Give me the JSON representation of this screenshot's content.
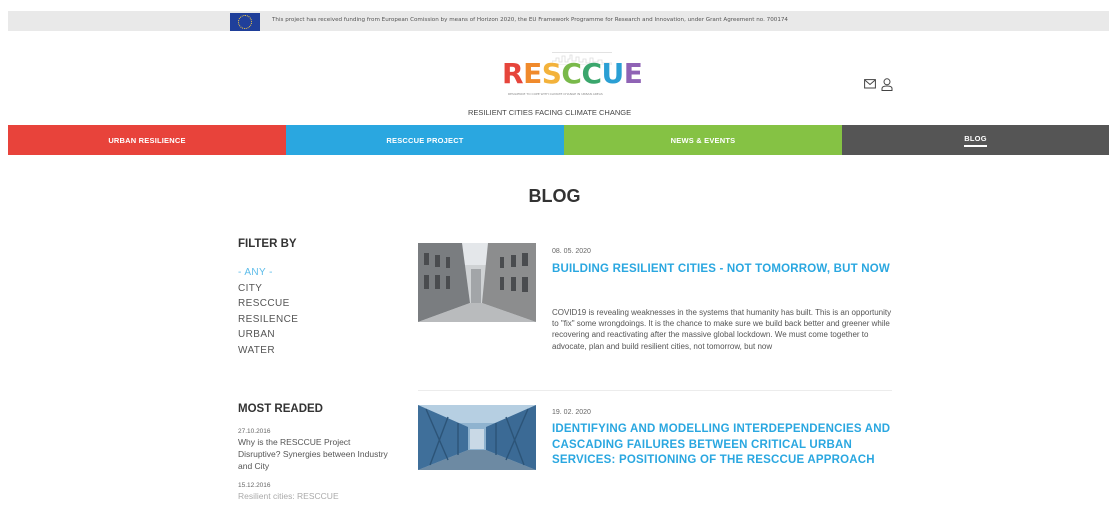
{
  "funding_notice": "This project has received funding from European Comission by means of Horizon 2020, the EU Framework Programme for Research and Innovation, under Grant Agreement no. 700174",
  "header": {
    "logo_letters": [
      "R",
      "E",
      "S",
      "C",
      "C",
      "U",
      "E"
    ],
    "logo_subtitle": "RESILIENCE TO COPE WITH CLIMATE CHANGE IN URBAN AREAS",
    "tagline": "RESILIENT CITIES FACING CLIMATE CHANGE",
    "icons": [
      "mail-icon",
      "user-icon"
    ]
  },
  "nav": {
    "items": [
      {
        "label": "URBAN RESILIENCE",
        "color": "#e8433b"
      },
      {
        "label": "RESCCUE PROJECT",
        "color": "#2aa7e0"
      },
      {
        "label": "NEWS & EVENTS",
        "color": "#85c244"
      },
      {
        "label": "BLOG",
        "color": "#555555",
        "active": true
      }
    ]
  },
  "page_title": "BLOG",
  "sidebar": {
    "filter_heading": "FILTER BY",
    "filters": [
      "- ANY -",
      "CITY",
      "RESCCUE",
      "RESILENCE",
      "URBAN",
      "WATER"
    ],
    "most_read_heading": "MOST READED",
    "most_read": [
      {
        "date": "27.10.2016",
        "title": "Why is the RESCCUE Project Disruptive? Synergies between Industry and City"
      },
      {
        "date": "15.12.2016",
        "title": "Resilient cities: RESCCUE"
      }
    ]
  },
  "posts": [
    {
      "date": "08. 05. 2020",
      "title": "BUILDING RESILIENT CITIES - NOT TOMORROW, BUT NOW",
      "excerpt": "COVID19 is revealing weaknesses in the systems that humanity has built. This is an opportunity to \"fix\" some wrongdoings. It is the chance to make sure we build back better and greener while recovering and reactivating after the massive global lockdown. We must come together to advocate, plan and build resilient cities, not tomorrow, but now",
      "image": "city-street-photo"
    },
    {
      "date": "19. 02. 2020",
      "title": "IDENTIFYING AND MODELLING INTERDEPENDENCIES AND CASCADING FAILURES BETWEEN CRITICAL URBAN SERVICES: POSITIONING OF THE RESCCUE APPROACH",
      "excerpt": "",
      "image": "steel-bridge-photo"
    }
  ]
}
